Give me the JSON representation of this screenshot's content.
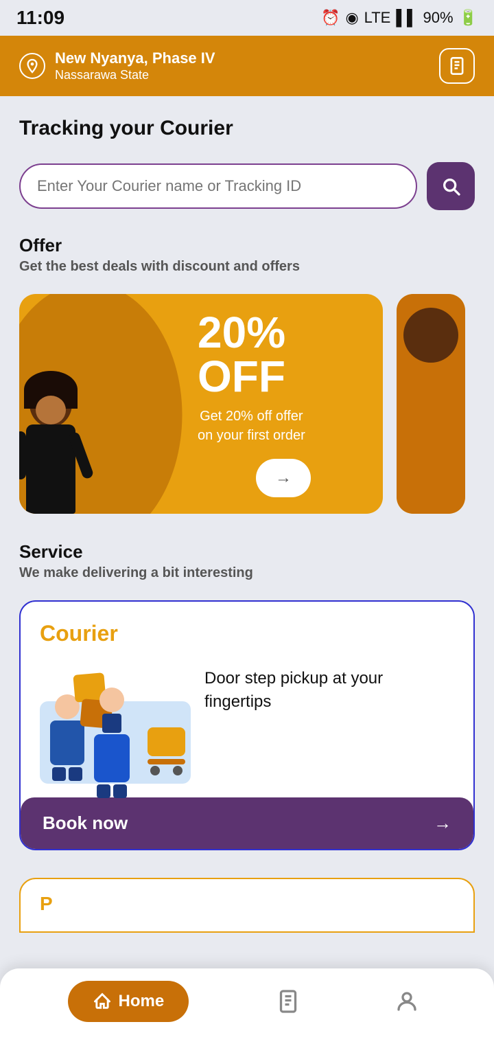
{
  "status_bar": {
    "time": "11:09",
    "battery": "90%",
    "icons": "🔔 📶 LTE ▌▌ 90%"
  },
  "header": {
    "location_name": "New Nyanya, Phase IV",
    "location_state": "Nassarawa State",
    "location_icon": "📍",
    "menu_icon": "📋"
  },
  "page": {
    "title": "Tracking your Courier"
  },
  "search": {
    "placeholder": "Enter Your Courier name or Tracking ID",
    "button_label": "Search"
  },
  "offer_section": {
    "title": "Offer",
    "subtitle": "Get the best deals with discount and offers",
    "cards": [
      {
        "percent": "20%",
        "off": "OFF",
        "description": "Get 20% off offer\non your first order",
        "button_label": "→"
      }
    ]
  },
  "service_section": {
    "title": "Service",
    "subtitle": "We make delivering a bit interesting",
    "card": {
      "label": "Courier",
      "description": "Door step pickup at your fingertips",
      "button_label": "Book now",
      "button_arrow": "→"
    }
  },
  "bottom_nav": {
    "home_label": "Home",
    "orders_label": "Orders",
    "profile_label": "Profile"
  }
}
